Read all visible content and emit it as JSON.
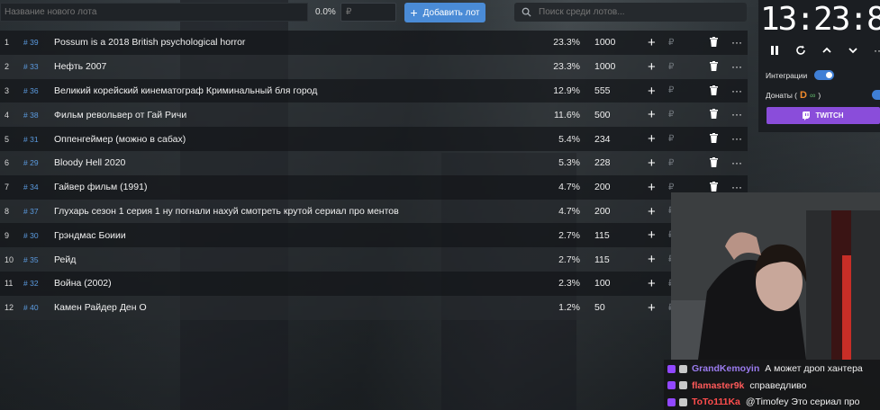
{
  "topbar": {
    "lot_name_placeholder": "Название нового лота",
    "percent": "0.0%",
    "amount_placeholder": "₽",
    "add_button_label": "Добавить лот",
    "search_placeholder": "Поиск среди лотов..."
  },
  "lots": [
    {
      "index": "1",
      "fast_id": "# 39",
      "title": "Possum is a 2018 British psychological horror",
      "percent": "23.3%",
      "amount": "1000"
    },
    {
      "index": "2",
      "fast_id": "# 33",
      "title": "Нефть 2007",
      "percent": "23.3%",
      "amount": "1000"
    },
    {
      "index": "3",
      "fast_id": "# 36",
      "title": "Великий корейский кинематограф Криминальный бля город",
      "percent": "12.9%",
      "amount": "555"
    },
    {
      "index": "4",
      "fast_id": "# 38",
      "title": "Фильм револьвер от Гай Ричи",
      "percent": "11.6%",
      "amount": "500"
    },
    {
      "index": "5",
      "fast_id": "# 31",
      "title": "Оппенгеймер (можно в сабах)",
      "percent": "5.4%",
      "amount": "234"
    },
    {
      "index": "6",
      "fast_id": "# 29",
      "title": "Bloody Hell 2020",
      "percent": "5.3%",
      "amount": "228"
    },
    {
      "index": "7",
      "fast_id": "# 34",
      "title": "Гайвер фильм (1991)",
      "percent": "4.7%",
      "amount": "200"
    },
    {
      "index": "8",
      "fast_id": "# 37",
      "title": "Глухарь сезон 1 серия 1 ну погнали нахуй смотреть крутой сериал про ментов",
      "percent": "4.7%",
      "amount": "200"
    },
    {
      "index": "9",
      "fast_id": "# 30",
      "title": "Грэндмас Боиии",
      "percent": "2.7%",
      "amount": "115"
    },
    {
      "index": "10",
      "fast_id": "# 35",
      "title": "Рейд",
      "percent": "2.7%",
      "amount": "115"
    },
    {
      "index": "11",
      "fast_id": "# 32",
      "title": "Война (2002)",
      "percent": "2.3%",
      "amount": "100"
    },
    {
      "index": "12",
      "fast_id": "# 40",
      "title": "Камен Райдер Ден О",
      "percent": "1.2%",
      "amount": "50"
    }
  ],
  "row_icons": {
    "plus": "+",
    "rub": "₽",
    "more": "···"
  },
  "timer": {
    "time": "13:23:8",
    "integrations_label": "Интеграции",
    "donations_label": "Донаты (",
    "donations_suffix": ")",
    "twitch_label": "TWITCH"
  },
  "chat": [
    {
      "user": "GrandKemoyin",
      "user_color": "#9b7cf0",
      "message": "А может дроп хантера "
    },
    {
      "user": "flamaster9k",
      "user_color": "#ff5a5a",
      "message": "справедливо"
    },
    {
      "user": "ToTo111Ka",
      "user_color": "#ff4d4d",
      "message": "@Timofey Это сериал про"
    }
  ],
  "colors": {
    "accent": "#4a8bd6",
    "twitch": "#8a4dda",
    "fast_id": "#5b9be0"
  }
}
